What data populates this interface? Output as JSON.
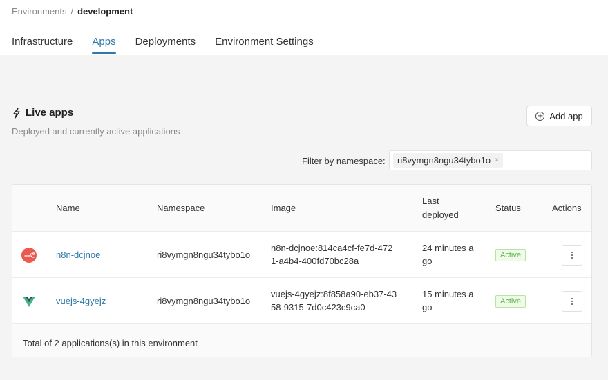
{
  "breadcrumb": {
    "parent": "Environments",
    "separator": "/",
    "current": "development"
  },
  "tabs": [
    {
      "label": "Infrastructure",
      "active": false
    },
    {
      "label": "Apps",
      "active": true
    },
    {
      "label": "Deployments",
      "active": false
    },
    {
      "label": "Environment Settings",
      "active": false
    }
  ],
  "section": {
    "icon": "bolt-icon",
    "title": "Live apps",
    "subtitle": "Deployed and currently active applications",
    "add_button_label": "Add app"
  },
  "filter": {
    "label": "Filter by namespace:",
    "chip_value": "ri8vymgn8ngu34tybo1o",
    "chip_remove": "×"
  },
  "table": {
    "columns": {
      "name": "Name",
      "namespace": "Namespace",
      "image": "Image",
      "last_deployed_1": "Last",
      "last_deployed_2": "deployed",
      "status": "Status",
      "actions": "Actions"
    },
    "rows": [
      {
        "icon": "n8n-icon",
        "name": "n8n-dcjnoe",
        "namespace": "ri8vymgn8ngu34tybo1o",
        "image_1": "n8n-dcjnoe:814ca4cf-fe7d-472",
        "image_2": "1-a4b4-400fd70bc28a",
        "deployed_1": "24 minutes a",
        "deployed_2": "go",
        "status": "Active"
      },
      {
        "icon": "vue-icon",
        "name": "vuejs-4gyejz",
        "namespace": "ri8vymgn8ngu34tybo1o",
        "image_1": "vuejs-4gyejz:8f858a90-eb37-43",
        "image_2": "58-9315-7d0c423c9ca0",
        "deployed_1": "15 minutes a",
        "deployed_2": "go",
        "status": "Active"
      }
    ],
    "footer": "Total of 2 applications(s) in this environment"
  },
  "colors": {
    "accent": "#2c7aa8",
    "status_active": "#5bb84a",
    "n8n_brand": "#ea4b71",
    "vue_brand": "#41b883"
  }
}
